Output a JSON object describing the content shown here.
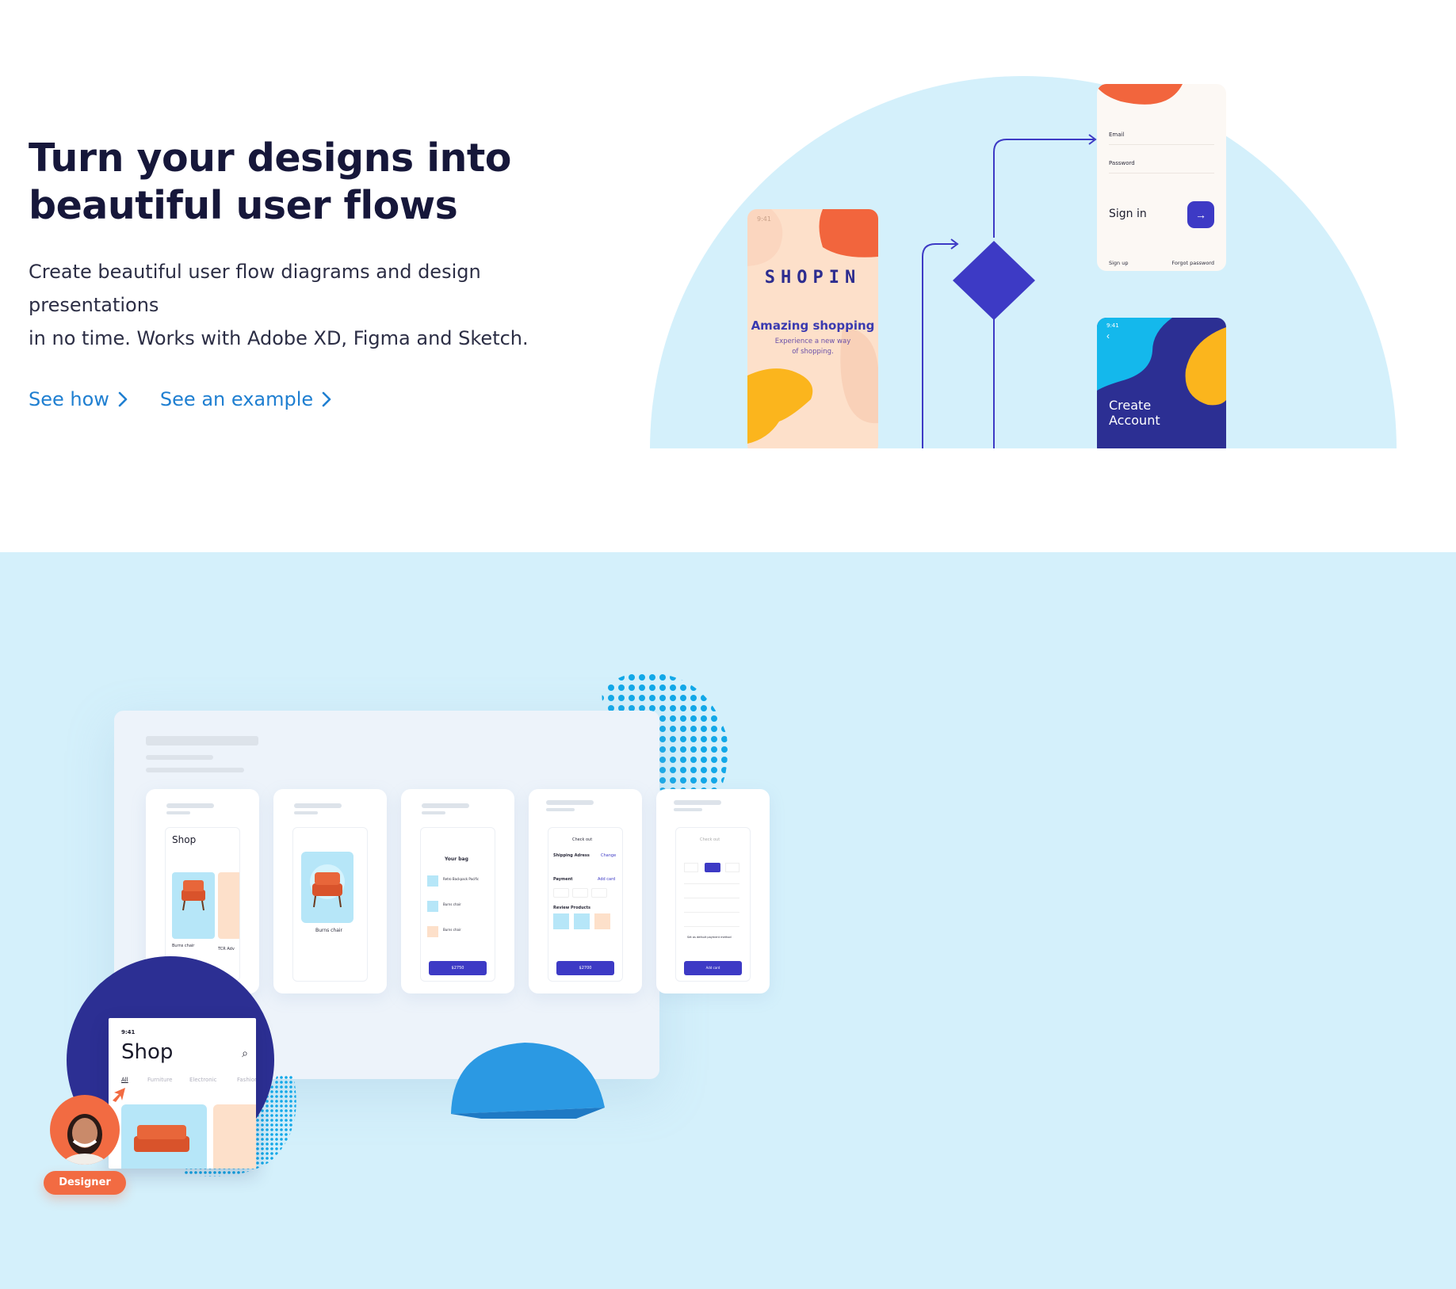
{
  "hero": {
    "title_lines": [
      "Turn your designs into",
      "beautiful user flows"
    ],
    "subtitle_lines": [
      "Create beautiful user flow diagrams and design presentations",
      "in no time. Works with Adobe XD, Figma and Sketch."
    ],
    "links": [
      {
        "label": "See how"
      },
      {
        "label": "See an example"
      }
    ]
  },
  "flow_illustration": {
    "shop_screen": {
      "time": "9:41",
      "brand": "SHOPIN",
      "headline": "Amazing shopping",
      "tagline_lines": [
        "Experience a new way",
        "of shopping."
      ]
    },
    "signin_screen": {
      "email_label": "Email",
      "password_label": "Password",
      "signin_label": "Sign in",
      "signup_label": "Sign up",
      "forgot_label": "Forgot password"
    },
    "create_screen": {
      "time": "9:41",
      "label_lines": [
        "Create",
        "Account"
      ]
    }
  },
  "presentation": {
    "cards": [
      {
        "title": "Shop",
        "items": [
          "Burns chair",
          "TCR Adv"
        ]
      },
      {
        "item": "Burns chair"
      },
      {
        "title": "Your bag",
        "items": [
          "Retro Backpack Pacific",
          "Burns chair",
          "Burns chair"
        ],
        "button": "$2750"
      },
      {
        "title": "Check out",
        "sections": [
          "Shipping Adress",
          "Payment",
          "Review Products"
        ],
        "action": "Change",
        "add": "Add card",
        "button": "$2700"
      },
      {
        "title": "Check out",
        "default_label": "Set as default payment method",
        "button": "Add card"
      }
    ],
    "foreground_phone": {
      "time": "9:41",
      "title": "Shop",
      "tabs": [
        "All",
        "Furniture",
        "Electronic",
        "Fashion"
      ]
    },
    "badge": "Designer"
  },
  "colors": {
    "accent_blue": "#1f7fd1",
    "indigo": "#3d3ac5",
    "navy": "#2c2f93",
    "coral": "#f26b42",
    "light_blue": "#d4f0fb"
  }
}
